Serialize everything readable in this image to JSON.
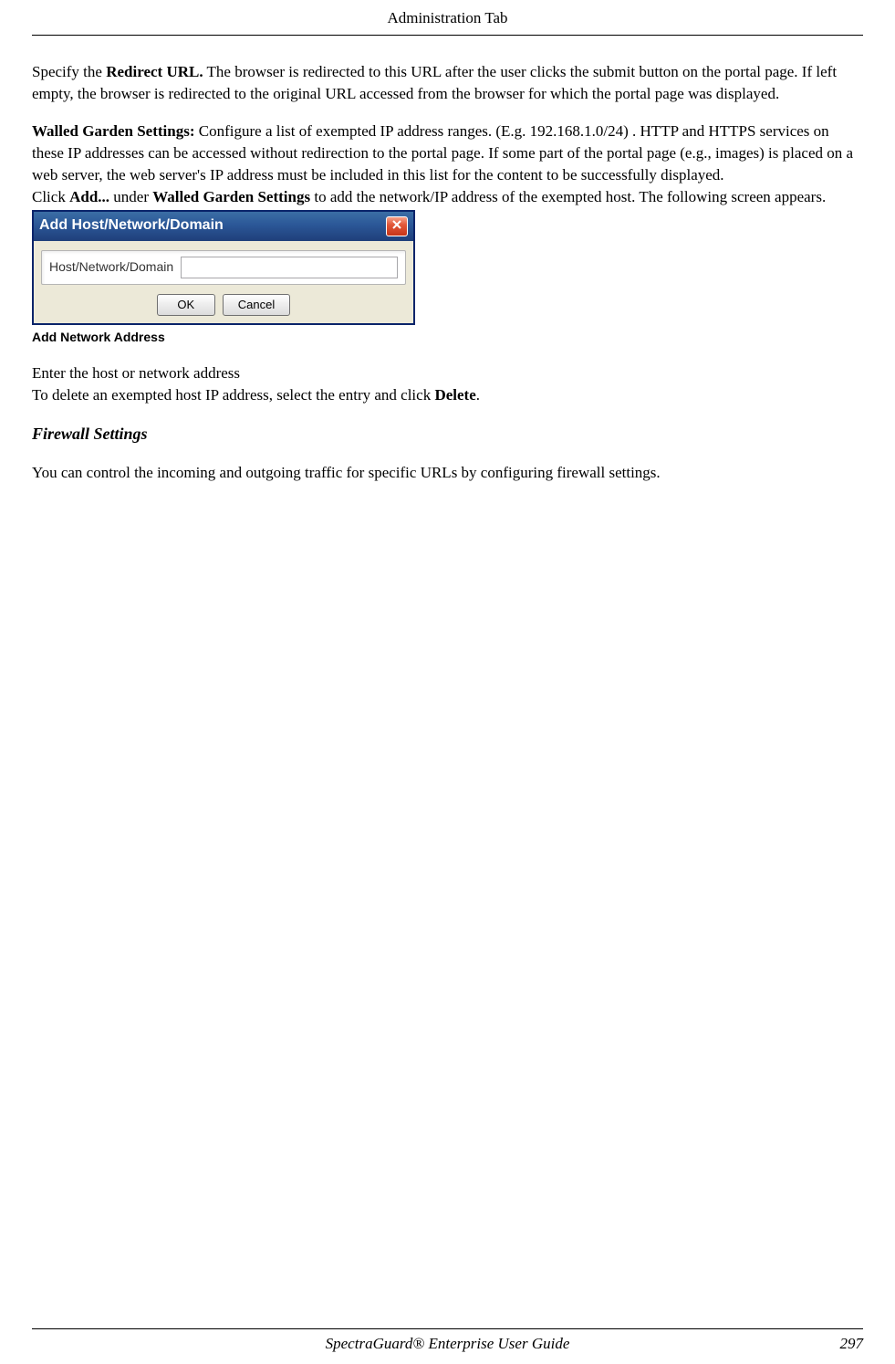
{
  "header": {
    "title": "Administration Tab"
  },
  "body": {
    "p1_pre": "Specify the ",
    "p1_bold": "Redirect URL.",
    "p1_post": "  The browser is redirected to this URL after the user clicks the submit button on the portal page. If left empty, the browser is redirected to the original URL accessed from the browser for which the portal page was displayed.",
    "p2_bold": "Walled Garden Settings:",
    "p2_post": " Configure a list of exempted IP address ranges. (E.g. 192.168.1.0/24) . HTTP and HTTPS services on these IP addresses can be accessed without redirection to the portal page.  If some part of the portal page (e.g., images) is placed on a web server, the web server's IP address must be included in this list for the content to be successfully displayed.",
    "p3_pre": "Click ",
    "p3_b1": "Add...",
    "p3_mid": "   under  ",
    "p3_b2": "Walled Garden Settings",
    "p3_post": " to add the network/IP address of the exempted host. The following screen appears.",
    "caption": "Add Network Address",
    "p4": " Enter the host or network address",
    "p5_pre": "To delete an exempted host IP address, select the entry and click ",
    "p5_bold": "Delete",
    "p5_post": ".",
    "section": "Firewall Settings",
    "p6": "You can control the incoming and outgoing traffic for specific URLs by configuring firewall settings."
  },
  "dialog": {
    "title": "Add Host/Network/Domain",
    "label": "Host/Network/Domain",
    "input_value": "",
    "ok": "OK",
    "cancel": "Cancel",
    "close": "X"
  },
  "footer": {
    "title": "SpectraGuard®  Enterprise User Guide",
    "page": "297"
  }
}
